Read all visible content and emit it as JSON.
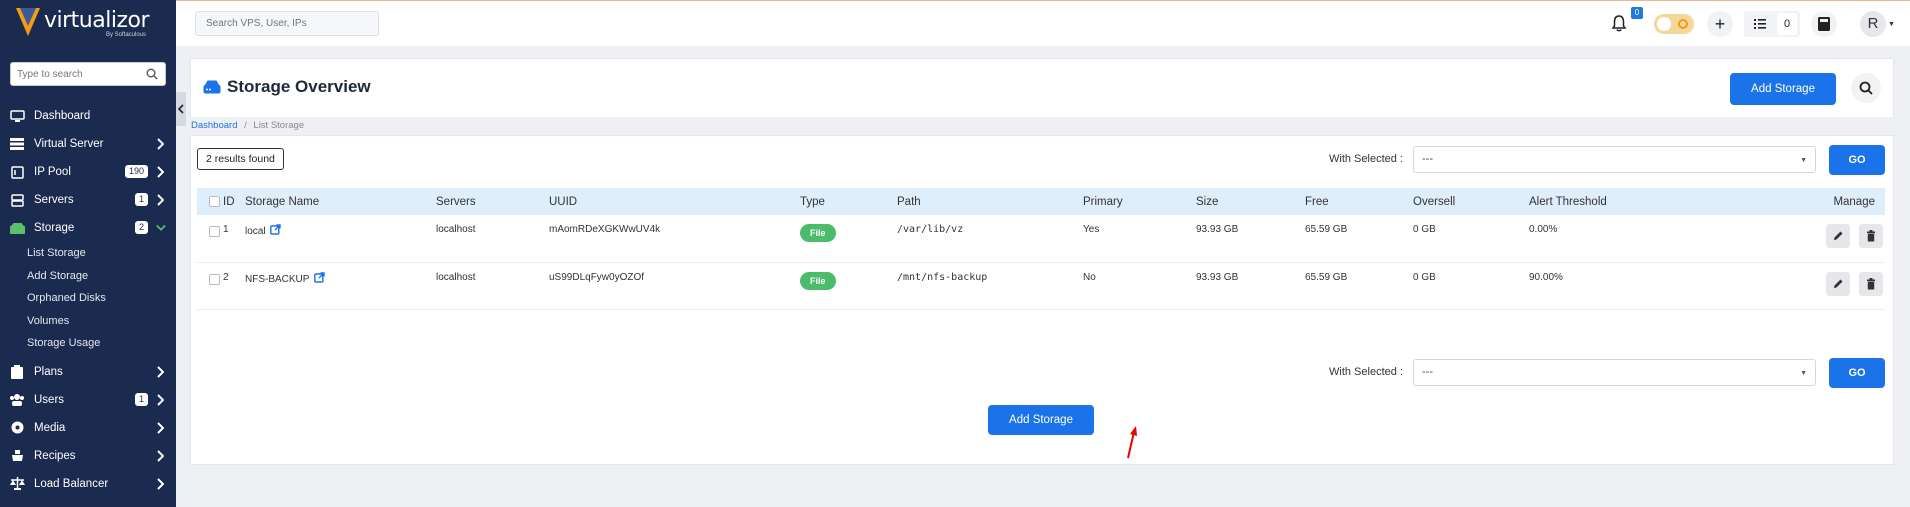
{
  "brand": {
    "name": "virtualizor",
    "sub": "By Softaculous"
  },
  "sidebar": {
    "search_placeholder": "Type to search",
    "items": [
      {
        "label": "Dashboard",
        "icon": "monitor-icon"
      },
      {
        "label": "Virtual Server",
        "icon": "server-list-icon"
      },
      {
        "label": "IP Pool",
        "icon": "ip-icon",
        "badge": "190"
      },
      {
        "label": "Servers",
        "icon": "server-icon",
        "badge": "1"
      },
      {
        "label": "Storage",
        "icon": "storage-icon",
        "badge": "2"
      },
      {
        "label": "Plans",
        "icon": "clipboard-icon"
      },
      {
        "label": "Users",
        "icon": "users-icon",
        "badge": "1"
      },
      {
        "label": "Media",
        "icon": "media-icon"
      },
      {
        "label": "Recipes",
        "icon": "recipes-icon"
      },
      {
        "label": "Load Balancer",
        "icon": "balance-icon"
      }
    ],
    "storage_sub": [
      "List Storage",
      "Add Storage",
      "Orphaned Disks",
      "Volumes",
      "Storage Usage"
    ]
  },
  "topbar": {
    "search_placeholder": "Search VPS, User, IPs",
    "notification_count": "0",
    "plus": "+",
    "task_count": "0",
    "avatar_letter": "R"
  },
  "page": {
    "title": "Storage Overview",
    "add_button": "Add Storage",
    "breadcrumb": {
      "home": "Dashboard",
      "sep": "/",
      "current": "List Storage"
    }
  },
  "results": "2 results found",
  "with_selected": {
    "label": "With Selected :",
    "value": "---",
    "go": "GO"
  },
  "table": {
    "columns": [
      "ID",
      "Storage Name",
      "Servers",
      "UUID",
      "Type",
      "Path",
      "Primary",
      "Size",
      "Free",
      "Oversell",
      "Alert Threshold",
      "Manage"
    ],
    "rows": [
      {
        "id": "1",
        "name": "local",
        "server": "localhost",
        "uuid": "mAomRDeXGKWwUV4k",
        "type": "File",
        "path": "/var/lib/vz",
        "primary": "Yes",
        "size": "93.93 GB",
        "free": "65.59 GB",
        "oversell": "0 GB",
        "alert": "0.00%"
      },
      {
        "id": "2",
        "name": "NFS-BACKUP",
        "server": "localhost",
        "uuid": "uS99DLqFyw0yOZOf",
        "type": "File",
        "path": "/mnt/nfs-backup",
        "primary": "No",
        "size": "93.93 GB",
        "free": "65.59 GB",
        "oversell": "0 GB",
        "alert": "90.00%"
      }
    ]
  },
  "bottom_add_button": "Add Storage",
  "colors": {
    "primary": "#1a73e8",
    "sidebar": "#1b2b4f",
    "file_pill": "#4cbb6c",
    "accent_green": "#5cc26a"
  }
}
